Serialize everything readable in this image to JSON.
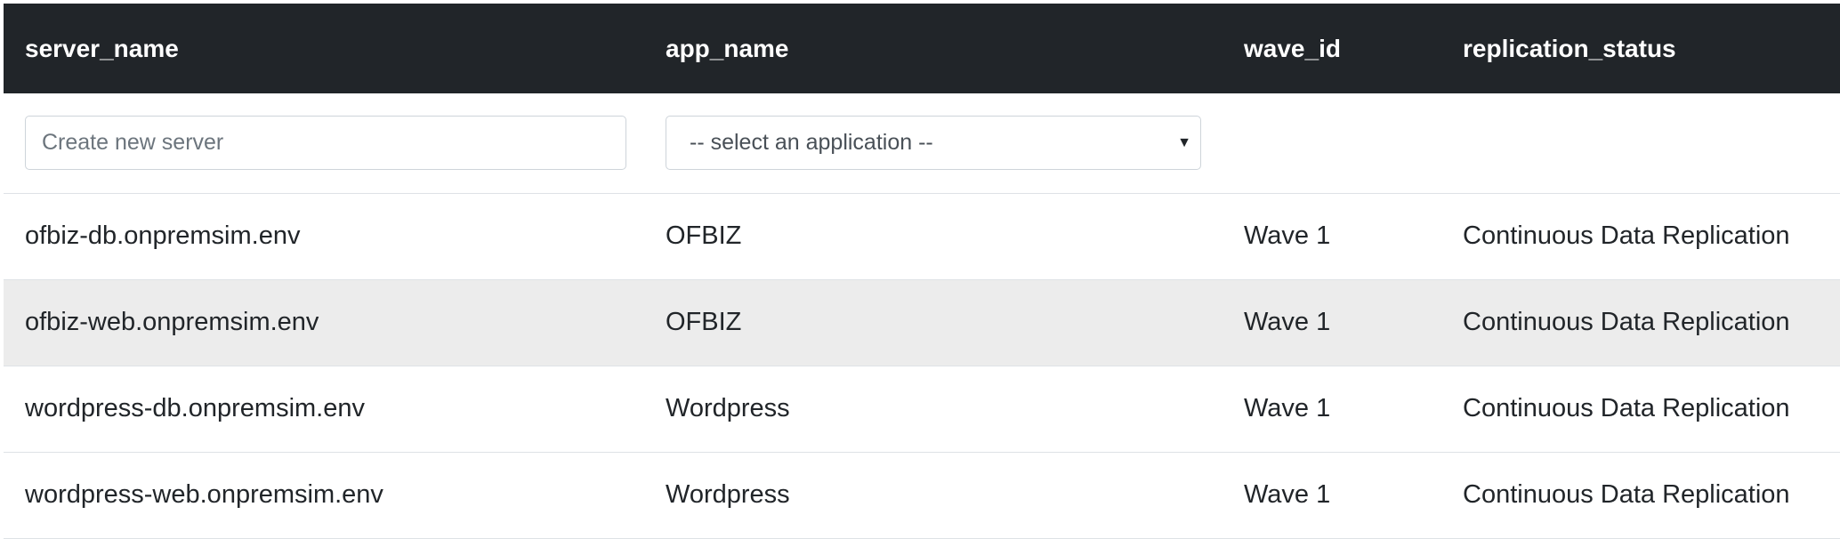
{
  "table": {
    "headers": [
      "server_name",
      "app_name",
      "wave_id",
      "replication_status"
    ],
    "create_row": {
      "server_placeholder": "Create new server",
      "app_select_value": "-- select an application --"
    },
    "rows": [
      {
        "server_name": "ofbiz-db.onpremsim.env",
        "app_name": "OFBIZ",
        "wave_id": "Wave 1",
        "replication_status": "Continuous Data Replication"
      },
      {
        "server_name": "ofbiz-web.onpremsim.env",
        "app_name": "OFBIZ",
        "wave_id": "Wave 1",
        "replication_status": "Continuous Data Replication"
      },
      {
        "server_name": "wordpress-db.onpremsim.env",
        "app_name": "Wordpress",
        "wave_id": "Wave 1",
        "replication_status": "Continuous Data Replication"
      },
      {
        "server_name": "wordpress-web.onpremsim.env",
        "app_name": "Wordpress",
        "wave_id": "Wave 1",
        "replication_status": "Continuous Data Replication"
      }
    ]
  },
  "icons": {
    "select_arrow": "caret-down-icon"
  },
  "colors": {
    "header_bg": "#212529",
    "header_text": "#ffffff",
    "stripe_bg": "#ececec",
    "border": "#dee2e6"
  }
}
